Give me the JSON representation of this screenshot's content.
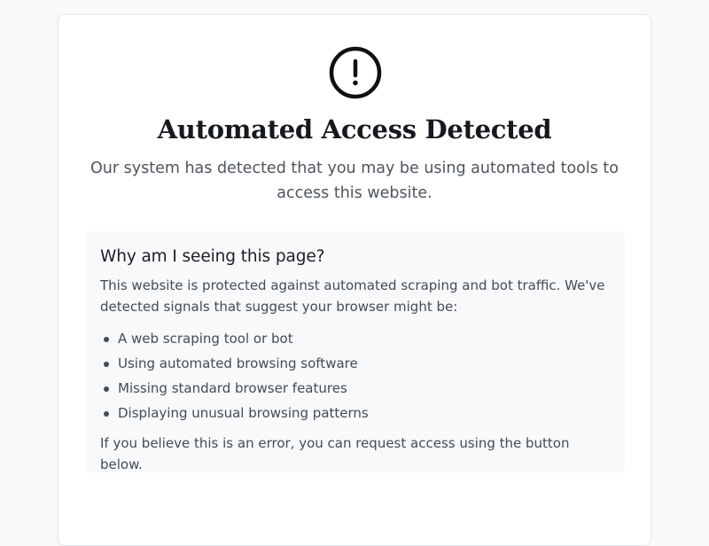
{
  "page": {
    "icon": "exclamation-circle-icon",
    "title": "Automated Access Detected",
    "subtitle": "Our system has detected that you may be using automated tools to access this website."
  },
  "info": {
    "heading": "Why am I seeing this page?",
    "intro": "This website is protected against automated scraping and bot traffic. We've detected signals that suggest your browser might be:",
    "reasons": [
      "A web scraping tool or bot",
      "Using automated browsing software",
      "Missing standard browser features",
      "Displaying unusual browsing patterns"
    ],
    "footer": "If you believe this is an error, you can request access using the button below."
  },
  "colors": {
    "page_background": "#f8f9fa",
    "card_background": "#ffffff",
    "info_background": "#f8f9fa",
    "icon": "#111111"
  }
}
